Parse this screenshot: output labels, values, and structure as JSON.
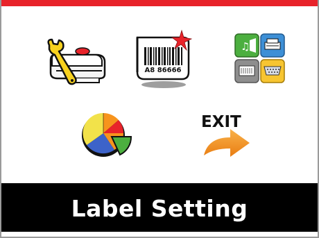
{
  "menu": {
    "items": [
      {
        "id": "setup",
        "icon": "printer-setup-wrench-icon"
      },
      {
        "id": "label",
        "icon": "barcode-label-icon",
        "barcode_text": "A8 86666"
      },
      {
        "id": "interface",
        "icon": "interface-ports-icon"
      },
      {
        "id": "stats",
        "icon": "pie-chart-icon"
      },
      {
        "id": "exit",
        "icon": "exit-arrow-icon",
        "label": "EXIT"
      }
    ]
  },
  "status_bar": {
    "title": "Label Setting"
  },
  "colors": {
    "top_bar": "#e8232a",
    "status_bar_bg": "#000000",
    "status_bar_text": "#ffffff",
    "arrow": "#f39c2f"
  }
}
